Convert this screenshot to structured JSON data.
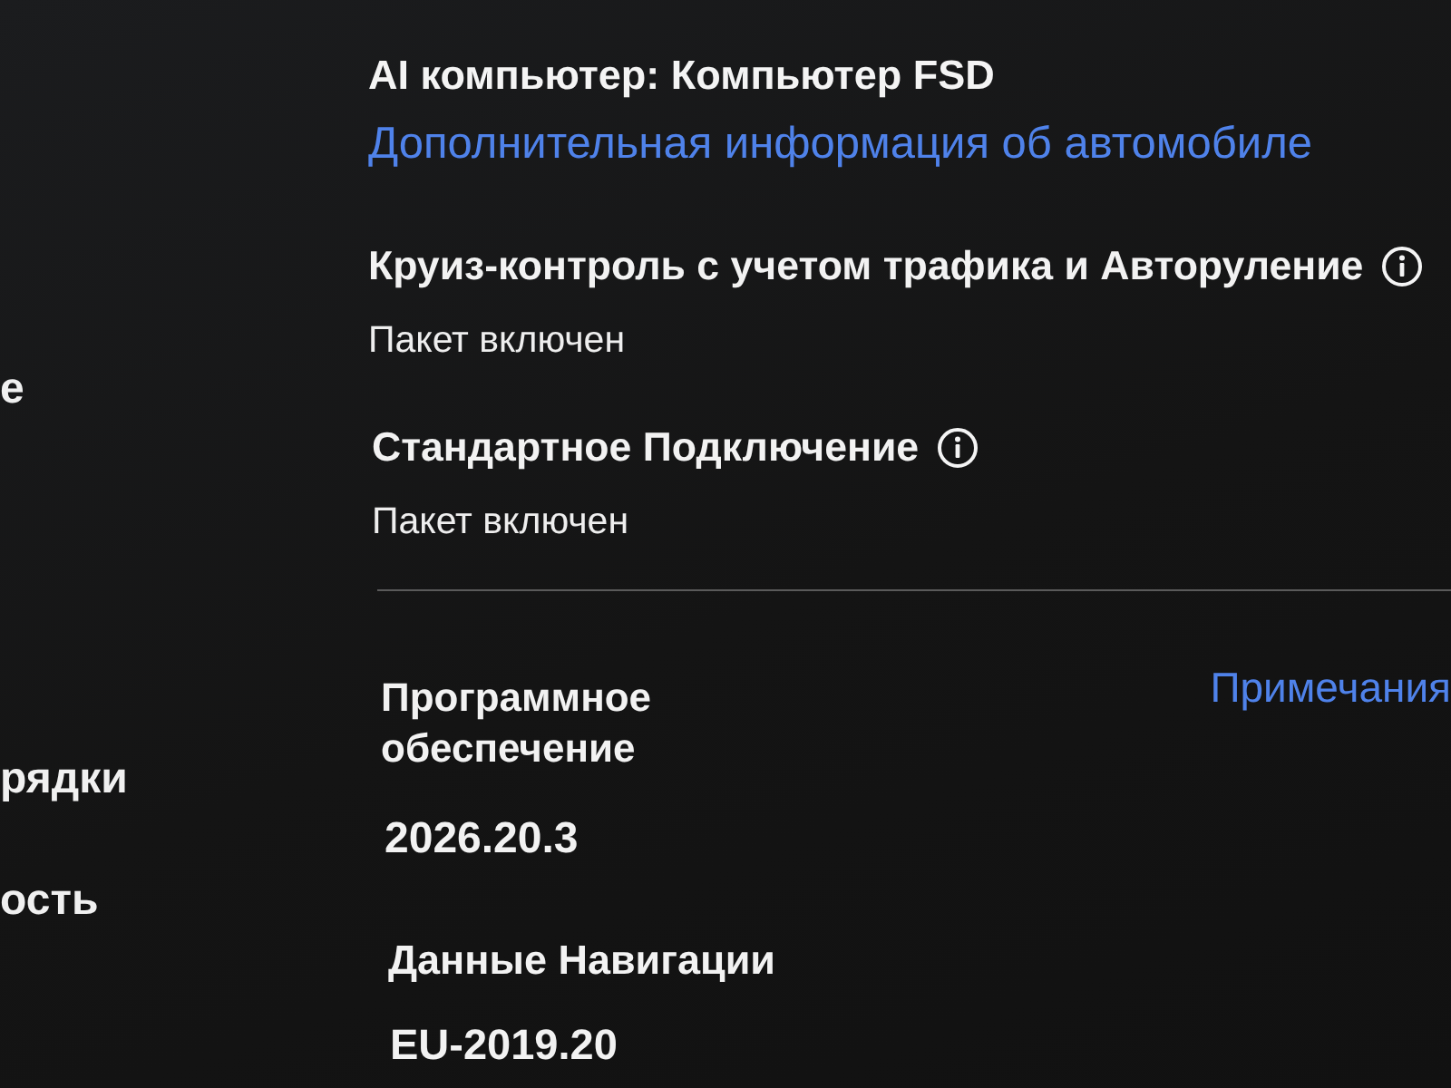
{
  "sidebar": {
    "items": [
      {
        "label": "е",
        "selected": false
      },
      {
        "label": "рядки",
        "selected": false
      },
      {
        "label": "ость",
        "selected": false
      }
    ]
  },
  "computer": "AI компьютер: Компьютер FSD",
  "vehicle_info_link": "Дополнительная информация об автомобиле",
  "packages": [
    {
      "name": "Круиз-контроль с учетом трафика и Авторуление",
      "status": "Пакет включен",
      "info": true
    },
    {
      "name": "Стандартное Подключение",
      "status": "Пакет включен",
      "info": true
    }
  ],
  "software": {
    "label": "Программное обеспечение",
    "version": "2026.20.3",
    "release_notes_link": "Примечания"
  },
  "navigation_data": {
    "label": "Данные Навигации",
    "version": "EU-2019.20"
  }
}
